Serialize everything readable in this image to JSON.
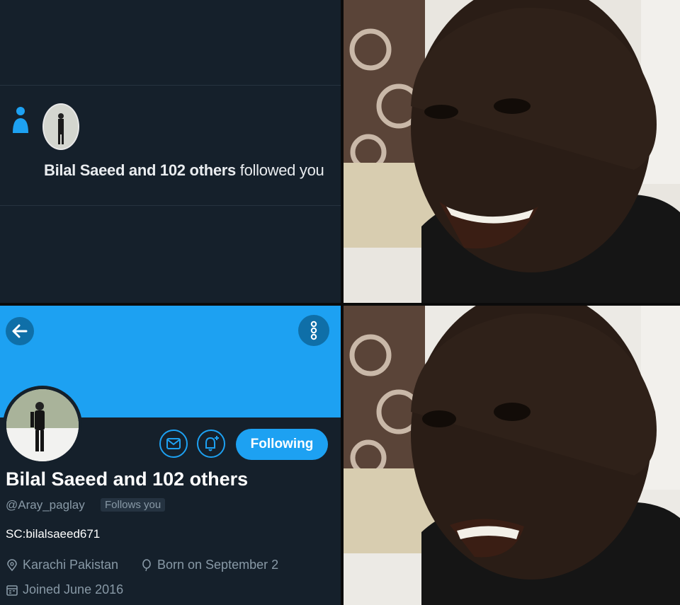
{
  "notification": {
    "actor": "Bilal Saeed",
    "rest": " and 102 others ",
    "action": "followed you"
  },
  "profile": {
    "name": "Bilal Saeed and 102 others",
    "handle": "@Aray_paglay",
    "follows_you": "Follows you",
    "following_label": "Following",
    "bio": "SC:bilalsaeed671",
    "location": "Karachi Pakistan",
    "birthday": "Born on September 2",
    "joined": "Joined June 2016"
  },
  "colors": {
    "background": "#15202b",
    "accent": "#1da1f2",
    "text_secondary": "#8899a6"
  },
  "icons": [
    "person-icon",
    "back-arrow-icon",
    "more-options-icon",
    "mail-icon",
    "bell-plus-icon",
    "location-pin-icon",
    "balloon-icon",
    "calendar-icon"
  ]
}
